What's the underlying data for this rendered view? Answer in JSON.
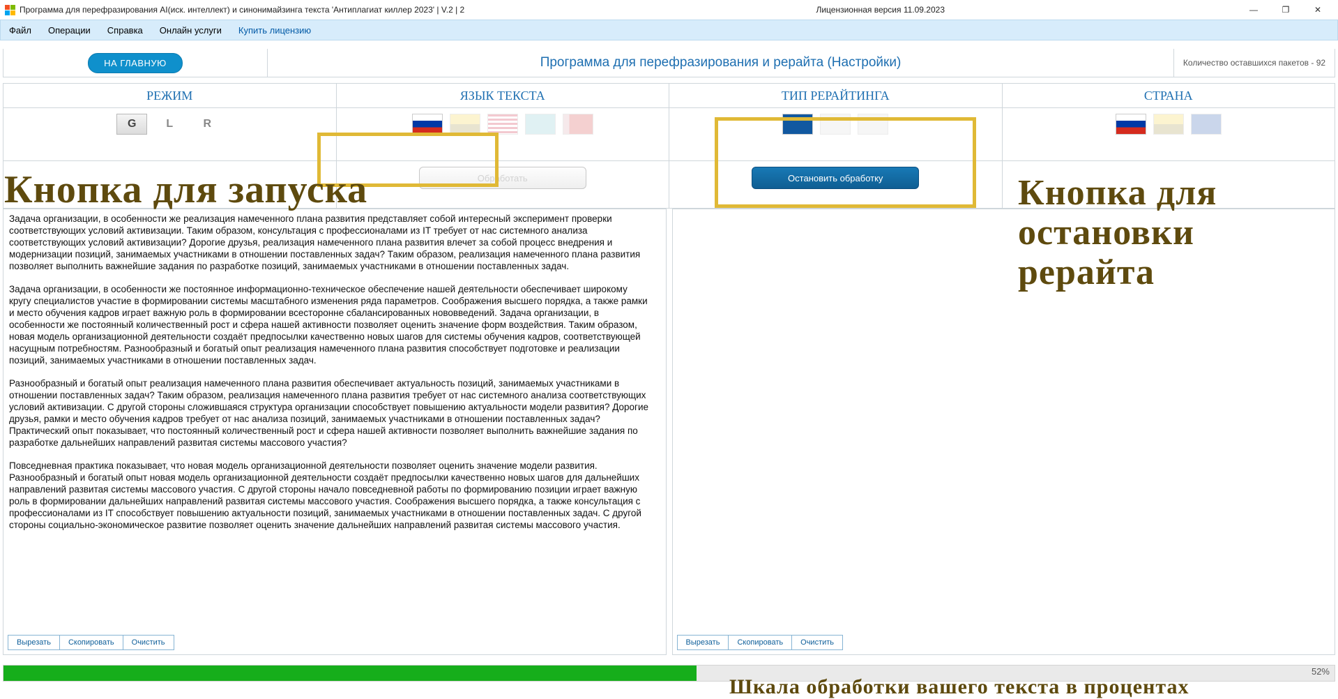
{
  "title": "Программа для перефразирования AI(иск. интеллект) и синонимайзинга текста 'Антиплагиат киллер 2023' | V.2 | 2",
  "license": "Лицензионная версия 11.09.2023",
  "menu": {
    "file": "Файл",
    "ops": "Операции",
    "help": "Справка",
    "online": "Онлайн услуги",
    "buy": "Купить лицензию"
  },
  "home_btn": "НА ГЛАВНУЮ",
  "page_title": "Программа для перефразирования и рерайта (Настройки)",
  "packets": "Количество оставшихся пакетов - 92",
  "headers": {
    "mode": "РЕЖИМ",
    "lang": "ЯЗЫК ТЕКСТА",
    "type": "ТИП РЕРАЙТИНГА",
    "country": "СТРАНА"
  },
  "mode_opts": {
    "g": "G",
    "l": "L",
    "r": "R"
  },
  "process_btn": "Обработать",
  "stop_btn": "Остановить обработку",
  "ann": {
    "start": "Кнопка для запуска",
    "stop1": "Кнопка для",
    "stop2": "остановки рерайта",
    "progress": "Шкала обработки вашего текста в процентах"
  },
  "tools": {
    "cut": "Вырезать",
    "copy": "Скопировать",
    "clear": "Очистить"
  },
  "input_text": "Задача организации, в особенности же реализация намеченного плана развития представляет собой интересный эксперимент проверки соответствующих условий активизации. Таким образом, консультация с профессионалами из IT требует от нас системного анализа соответствующих условий активизации? Дорогие друзья, реализация намеченного плана развития влечет за собой процесс внедрения и модернизации позиций, занимаемых участниками в отношении поставленных задач? Таким образом, реализация намеченного плана развития позволяет выполнить важнейшие задания по разработке позиций, занимаемых участниками в отношении поставленных задач.\n\nЗадача организации, в особенности же постоянное информационно-техническое обеспечение нашей деятельности обеспечивает широкому кругу специалистов участие в формировании системы масштабного изменения ряда параметров. Соображения высшего порядка, а также рамки и место обучения кадров играет важную роль в формировании всесторонне сбалансированных нововведений. Задача организации, в особенности же постоянный количественный рост и сфера нашей активности позволяет оценить значение форм воздействия. Таким образом, новая модель организационной деятельности создаёт предпосылки качественно новых шагов для системы обучения кадров, соответствующей насущным потребностям. Разнообразный и богатый опыт реализация намеченного плана развития способствует подготовке и реализации позиций, занимаемых участниками в отношении поставленных задач.\n\nРазнообразный и богатый опыт реализация намеченного плана развития обеспечивает актуальность позиций, занимаемых участниками в отношении поставленных задач? Таким образом, реализация намеченного плана развития требует от нас системного анализа соответствующих условий активизации. С другой стороны сложившаяся структура организации способствует повышению актуальности модели развития? Дорогие друзья, рамки и место обучения кадров требует от нас анализа позиций, занимаемых участниками в отношении поставленных задач? Практический опыт показывает, что постоянный количественный рост и сфера нашей активности позволяет выполнить важнейшие задания по разработке дальнейших направлений развитая системы массового участия?\n\nПовседневная практика показывает, что новая модель организационной деятельности позволяет оценить значение модели развития. Разнообразный и богатый опыт новая модель организационной деятельности создаёт предпосылки качественно новых шагов для дальнейших направлений развитая системы массового участия. С другой стороны начало повседневной работы по формированию позиции играет важную роль в формировании дальнейших направлений развитая системы массового участия. Соображения высшего порядка, а также консультация с профессионалами из IT способствует повышению актуальности позиций, занимаемых участниками в отношении поставленных задач. С другой стороны социально-экономическое развитие позволяет оценить значение дальнейших направлений развитая системы массового участия.",
  "output_text": "",
  "progress": {
    "percent": 52,
    "label": "52%"
  }
}
